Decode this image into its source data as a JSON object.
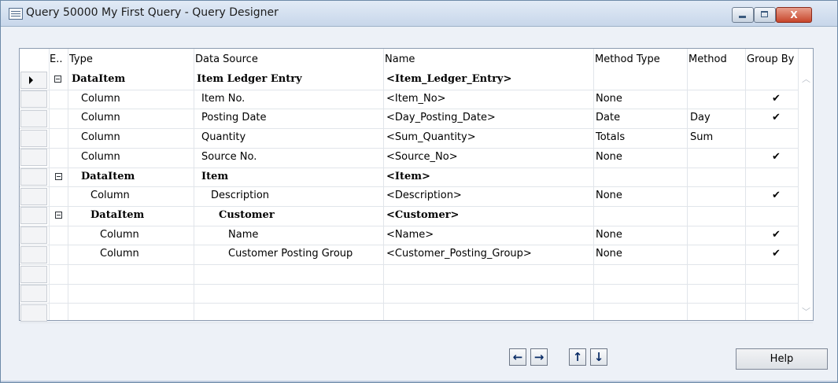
{
  "window": {
    "title": "Query 50000 My First Query - Query Designer",
    "close_glyph": "X"
  },
  "columns": {
    "expand": "E..",
    "type": "Type",
    "data_source": "Data Source",
    "name": "Name",
    "method_type": "Method Type",
    "method": "Method",
    "group_by": "Group By"
  },
  "rows": [
    {
      "type": "DataItem",
      "data_source": "Item Ledger Entry",
      "name": "<Item_Ledger_Entry>",
      "method_type": "",
      "method": "",
      "group_by": "",
      "bold": true,
      "expander": true,
      "current": true
    },
    {
      "type": "Column",
      "data_source": "Item No.",
      "name": "<Item_No>",
      "method_type": "None",
      "method": "",
      "group_by": "✔"
    },
    {
      "type": "Column",
      "data_source": "Posting Date",
      "name": "<Day_Posting_Date>",
      "method_type": "Date",
      "method": "Day",
      "group_by": "✔"
    },
    {
      "type": "Column",
      "data_source": "Quantity",
      "name": "<Sum_Quantity>",
      "method_type": "Totals",
      "method": "Sum",
      "group_by": ""
    },
    {
      "type": "Column",
      "data_source": "Source No.",
      "name": "<Source_No>",
      "method_type": "None",
      "method": "",
      "group_by": "✔"
    },
    {
      "type": "DataItem",
      "data_source": "Item",
      "name": "<Item>",
      "method_type": "",
      "method": "",
      "group_by": "",
      "bold": true,
      "expander": true
    },
    {
      "type": "Column",
      "data_source": "Description",
      "name": "<Description>",
      "method_type": "None",
      "method": "",
      "group_by": "✔"
    },
    {
      "type": "DataItem",
      "data_source": "Customer",
      "name": "<Customer>",
      "method_type": "",
      "method": "",
      "group_by": "",
      "bold": true,
      "expander": true
    },
    {
      "type": "Column",
      "data_source": "Name",
      "name": "<Name>",
      "method_type": "None",
      "method": "",
      "group_by": "✔"
    },
    {
      "type": "Column",
      "data_source": "Customer Posting Group",
      "name": "<Customer_Posting_Group>",
      "method_type": "None",
      "method": "",
      "group_by": "✔"
    }
  ],
  "footer": {
    "nav_left": "←",
    "nav_right": "→",
    "nav_up": "↑",
    "nav_down": "↓",
    "help_label": "Help"
  },
  "colors": {
    "accent": "#c7452b",
    "title_gradient_top": "#e2ebf6",
    "title_gradient_bottom": "#c7d6ea"
  }
}
